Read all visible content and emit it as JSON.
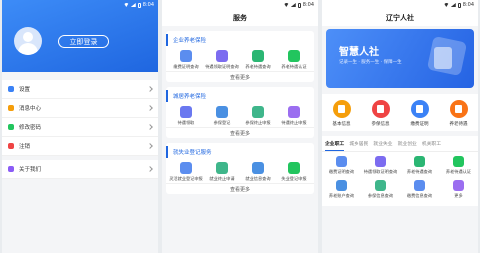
{
  "status": {
    "time": "8:04"
  },
  "profile": {
    "login_button": "立即登录",
    "menu": [
      {
        "label": "设置",
        "color": "#3b82f6"
      },
      {
        "label": "消息中心",
        "color": "#f59e0b"
      },
      {
        "label": "修改密码",
        "color": "#22c55e"
      },
      {
        "label": "注销",
        "color": "#ef4444"
      }
    ],
    "menu2": [
      {
        "label": "关于我们",
        "color": "#8b5cf6"
      }
    ]
  },
  "services": {
    "title": "服务",
    "sections": [
      {
        "title": "企业养老保险",
        "items": [
          {
            "label": "缴费证明查询",
            "color": "#5b8def"
          },
          {
            "label": "待遇领取证明查询",
            "color": "#7c6cf0"
          },
          {
            "label": "养老待遇查询",
            "color": "#2bb673"
          },
          {
            "label": "养老待遇认证",
            "color": "#22c55e"
          }
        ],
        "more": "查看更多"
      },
      {
        "title": "城居养老保险",
        "items": [
          {
            "label": "待遇领取",
            "color": "#6a78f0"
          },
          {
            "label": "参保登记",
            "color": "#4a90e2"
          },
          {
            "label": "参保终止申报",
            "color": "#3fb68b"
          },
          {
            "label": "待遇终止申报",
            "color": "#9b6ef0"
          }
        ],
        "more": "查看更多"
      },
      {
        "title": "就失业登记服务",
        "items": [
          {
            "label": "灵活就业登记申报",
            "color": "#5b8def"
          },
          {
            "label": "就业终止申请",
            "color": "#3fb68b"
          },
          {
            "label": "就业信息查询",
            "color": "#4a90e2"
          },
          {
            "label": "失业登记申报",
            "color": "#22c55e"
          }
        ],
        "more": "查看更多"
      }
    ]
  },
  "home": {
    "title": "辽宁人社",
    "banner": {
      "title": "智慧人社",
      "slogan": "记录一生 · 服务一生 · 保障一生"
    },
    "quick": [
      {
        "label": "基本信息",
        "color": "#f59e0b"
      },
      {
        "label": "参保信息",
        "color": "#ef4444"
      },
      {
        "label": "缴费证明",
        "color": "#3b82f6"
      },
      {
        "label": "养老待遇",
        "color": "#f97316"
      }
    ],
    "tabs": [
      "企业职工",
      "城乡居民",
      "就业失业",
      "就业创业",
      "机关职工"
    ],
    "grid": [
      {
        "label": "缴费证明查询",
        "color": "#5b8def"
      },
      {
        "label": "待遇领取证明查询",
        "color": "#7c6cf0"
      },
      {
        "label": "养老待遇查询",
        "color": "#2bb673"
      },
      {
        "label": "养老待遇认证",
        "color": "#22c55e"
      },
      {
        "label": "养老账户查询",
        "color": "#4a90e2"
      },
      {
        "label": "参保信息查询",
        "color": "#3fb68b"
      },
      {
        "label": "缴费信息查询",
        "color": "#5b8def"
      },
      {
        "label": "更多",
        "color": "#9b6ef0"
      }
    ]
  }
}
